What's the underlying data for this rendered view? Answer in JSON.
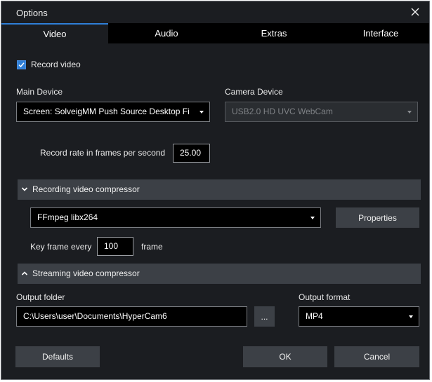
{
  "window": {
    "title": "Options"
  },
  "tabs": [
    {
      "label": "Video",
      "active": true
    },
    {
      "label": "Audio",
      "active": false
    },
    {
      "label": "Extras",
      "active": false
    },
    {
      "label": "Interface",
      "active": false
    }
  ],
  "record_video": {
    "label": "Record video",
    "checked": true
  },
  "main_device": {
    "label": "Main Device",
    "value": "Screen: SolveigMM Push Source Desktop Fi"
  },
  "camera_device": {
    "label": "Camera Device",
    "value": "USB2.0 HD UVC WebCam",
    "disabled": true
  },
  "frame_rate": {
    "label": "Record rate in frames per second",
    "value": "25.00"
  },
  "recording_compressor": {
    "header": "Recording video compressor",
    "expanded": true,
    "codec": "FFmpeg libx264",
    "properties_label": "Properties",
    "keyframe_label": "Key frame every",
    "keyframe_value": "100",
    "keyframe_unit": "frame"
  },
  "streaming_compressor": {
    "header": "Streaming video compressor",
    "expanded": false
  },
  "output_folder": {
    "label": "Output folder",
    "value": "C:\\Users\\user\\Documents\\HyperCam6",
    "browse_label": "..."
  },
  "output_format": {
    "label": "Output format",
    "value": "MP4"
  },
  "buttons": {
    "defaults": "Defaults",
    "ok": "OK",
    "cancel": "Cancel"
  },
  "colors": {
    "accent": "#2f7fd8",
    "background": "#1b1d21",
    "panel": "#3c4046",
    "field": "#000000"
  }
}
